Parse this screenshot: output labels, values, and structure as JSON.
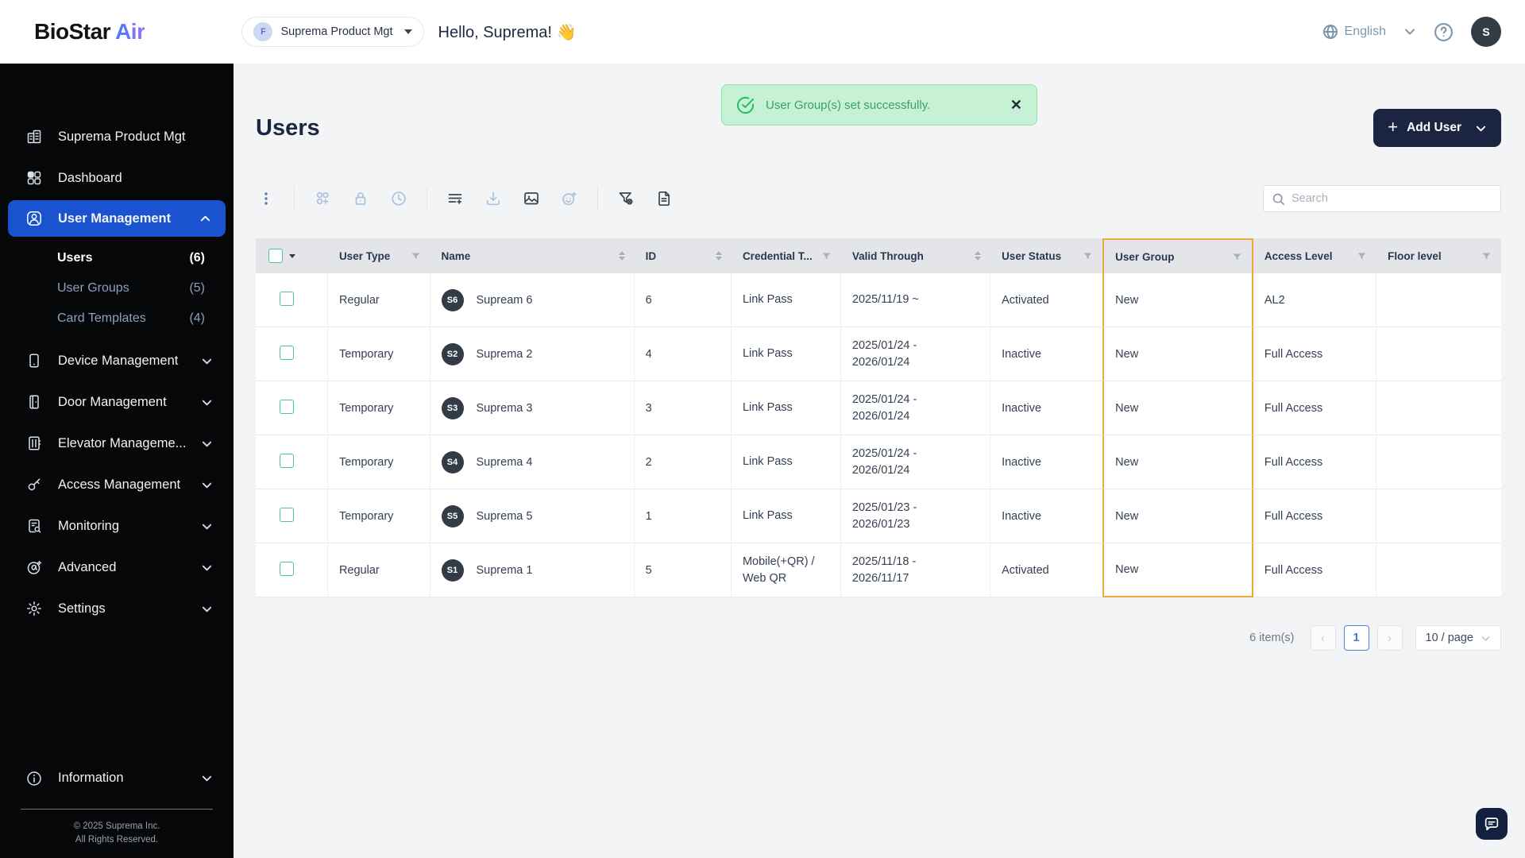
{
  "colors": {
    "active_blue": "#1a53cf",
    "accent_blue": "#3f7dff",
    "highlight_orange": "#eda83e",
    "toast_bg": "#c7f1d4"
  },
  "header": {
    "logo_primary": "BioStar",
    "logo_accent": "Air",
    "org_badge": "F",
    "org_name": "Suprema Product Mgt",
    "greeting": "Hello, Suprema! 👋",
    "language": "English",
    "avatar_initial": "S"
  },
  "sidebar": {
    "items": [
      {
        "label": "Suprema Product Mgt",
        "icon": "building-icon"
      },
      {
        "label": "Dashboard",
        "icon": "dashboard-icon"
      },
      {
        "label": "User Management",
        "icon": "user-icon"
      },
      {
        "label": "Device Management",
        "icon": "device-icon"
      },
      {
        "label": "Door Management",
        "icon": "door-icon"
      },
      {
        "label": "Elevator Manageme...",
        "icon": "elevator-icon"
      },
      {
        "label": "Access Management",
        "icon": "key-icon"
      },
      {
        "label": "Monitoring",
        "icon": "monitoring-icon"
      },
      {
        "label": "Advanced",
        "icon": "advanced-icon"
      },
      {
        "label": "Settings",
        "icon": "settings-icon"
      }
    ],
    "sub_items": [
      {
        "label": "Users",
        "count": "(6)"
      },
      {
        "label": "User Groups",
        "count": "(5)"
      },
      {
        "label": "Card Templates",
        "count": "(4)"
      }
    ],
    "information_label": "Information",
    "copyright_line1": "© 2025 Suprema Inc.",
    "copyright_line2": "All Rights Reserved."
  },
  "toast": {
    "message": "User Group(s) set successfully."
  },
  "page": {
    "title": "Users",
    "add_user": "Add User"
  },
  "toolbar": {
    "icons": [
      "more-vertical-icon",
      "assign-group-icon",
      "lock-icon",
      "history-clock-icon",
      "list-settings-icon",
      "download-icon",
      "image-icon",
      "add-face-icon",
      "clear-filter-icon",
      "report-file-icon"
    ]
  },
  "search": {
    "placeholder": "Search"
  },
  "table": {
    "columns": [
      {
        "label": "",
        "icon": "checkbox"
      },
      {
        "label": "User Type",
        "icon": "filter"
      },
      {
        "label": "Name",
        "icon": "sort"
      },
      {
        "label": "ID",
        "icon": "sort"
      },
      {
        "label": "Credential T...",
        "icon": "filter"
      },
      {
        "label": "Valid Through",
        "icon": "sort"
      },
      {
        "label": "User Status",
        "icon": "filter"
      },
      {
        "label": "User Group",
        "icon": "filter",
        "highlighted": true
      },
      {
        "label": "Access Level",
        "icon": "filter"
      },
      {
        "label": "Floor level",
        "icon": "filter"
      }
    ],
    "rows": [
      {
        "user_type": "Regular",
        "avatar": "S6",
        "name": "Supream 6",
        "id": "6",
        "credential": "Link Pass",
        "valid": "2025/11/19 ~",
        "status": "Activated",
        "group": "New",
        "access": "AL2",
        "floor": ""
      },
      {
        "user_type": "Temporary",
        "avatar": "S2",
        "name": "Suprema 2",
        "id": "4",
        "credential": "Link Pass",
        "valid": "2025/01/24 -\n2026/01/24",
        "status": "Inactive",
        "group": "New",
        "access": "Full Access",
        "floor": ""
      },
      {
        "user_type": "Temporary",
        "avatar": "S3",
        "name": "Suprema 3",
        "id": "3",
        "credential": "Link Pass",
        "valid": "2025/01/24 -\n2026/01/24",
        "status": "Inactive",
        "group": "New",
        "access": "Full Access",
        "floor": ""
      },
      {
        "user_type": "Temporary",
        "avatar": "S4",
        "name": "Suprema 4",
        "id": "2",
        "credential": "Link Pass",
        "valid": "2025/01/24 -\n2026/01/24",
        "status": "Inactive",
        "group": "New",
        "access": "Full Access",
        "floor": ""
      },
      {
        "user_type": "Temporary",
        "avatar": "S5",
        "name": "Suprema 5",
        "id": "1",
        "credential": "Link Pass",
        "valid": "2025/01/23 -\n2026/01/23",
        "status": "Inactive",
        "group": "New",
        "access": "Full Access",
        "floor": ""
      },
      {
        "user_type": "Regular",
        "avatar": "S1",
        "name": "Suprema 1",
        "id": "5",
        "credential": "Mobile(+QR) /\nWeb QR",
        "valid": "2025/11/18 -\n2026/11/17",
        "status": "Activated",
        "group": "New",
        "access": "Full Access",
        "floor": ""
      }
    ]
  },
  "pagination": {
    "total": "6 item(s)",
    "current_page": "1",
    "page_size": "10 / page"
  }
}
